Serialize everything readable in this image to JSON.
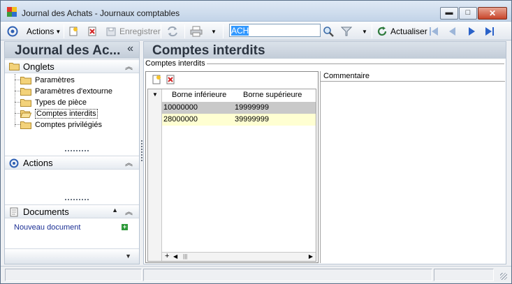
{
  "window": {
    "title": "Journal des Achats -  Journaux comptables",
    "controls": {
      "minimize": "▬",
      "maximize": "□",
      "close": "✕"
    }
  },
  "toolbar": {
    "actions_label": "Actions",
    "save_label": "Enregistrer",
    "search_value": "ACH",
    "refresh_label": "Actualiser"
  },
  "sidebar": {
    "title": "Journal des Ac...",
    "collapse_glyph": "«",
    "onglets": {
      "title": "Onglets",
      "items": [
        {
          "label": "Paramètres"
        },
        {
          "label": "Paramètres d'extourne"
        },
        {
          "label": "Types de pièce"
        },
        {
          "label": "Comptes interdits"
        },
        {
          "label": "Comptes privilégiés"
        }
      ]
    },
    "actions": {
      "title": "Actions"
    },
    "documents": {
      "title": "Documents",
      "new_document": "Nouveau document"
    }
  },
  "main": {
    "title": "Comptes interdits",
    "group_label": "Comptes interdits",
    "grid": {
      "columns": [
        "Borne inférieure",
        "Borne supérieure"
      ],
      "rows": [
        {
          "lower": "10000000",
          "upper": "19999999"
        },
        {
          "lower": "28000000",
          "upper": "39999999"
        }
      ]
    },
    "comment_label": "Commentaire"
  },
  "colors": {
    "selected_row": "#c9c9c9",
    "alt_row": "#ffffd2",
    "link": "#1b2f94"
  }
}
